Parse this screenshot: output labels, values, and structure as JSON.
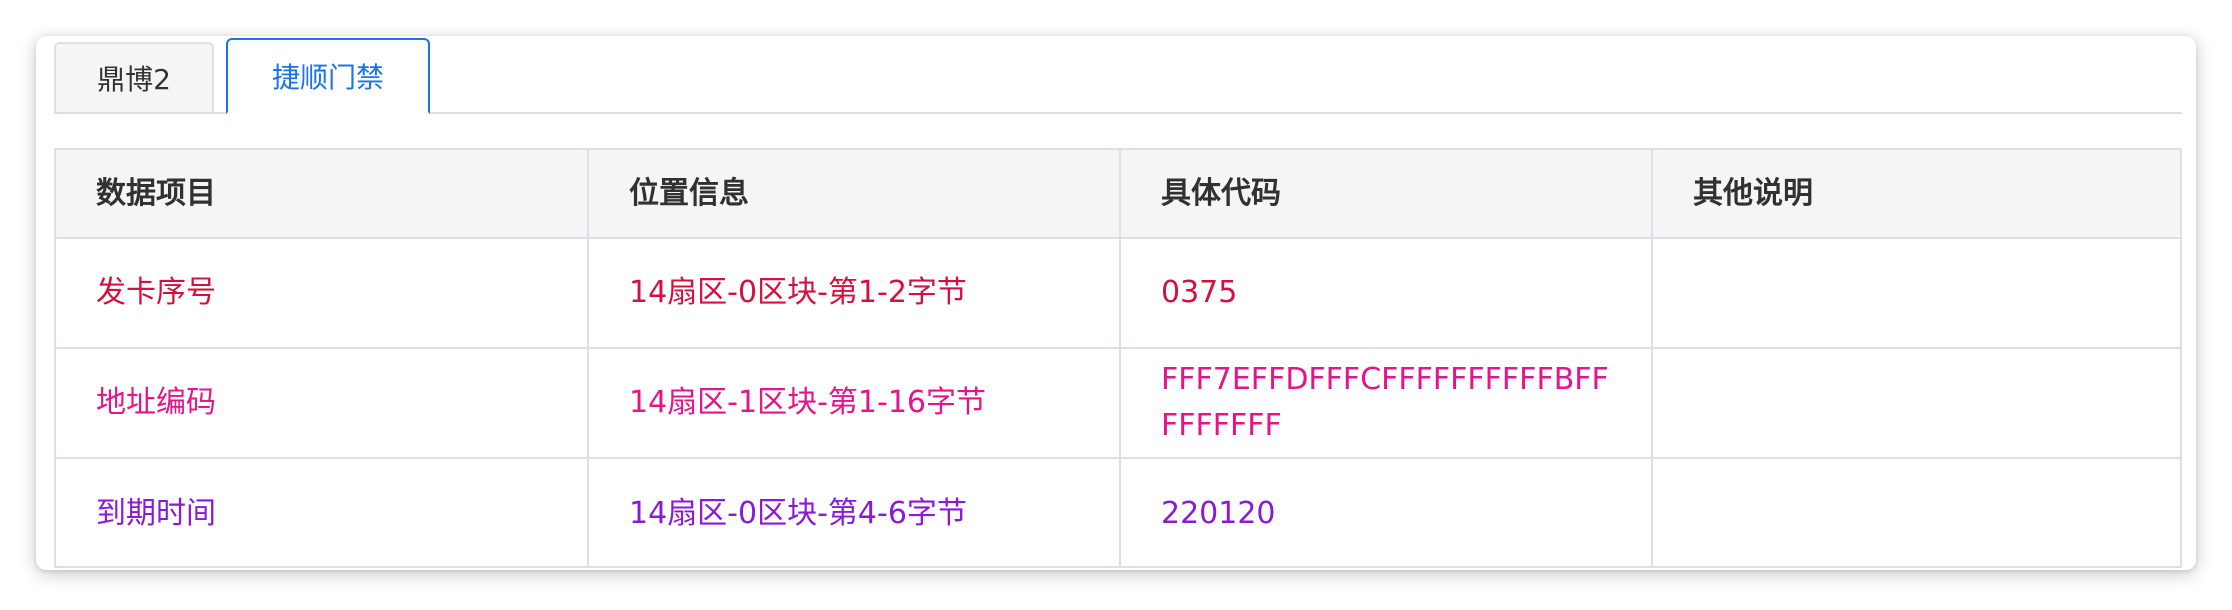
{
  "tabs": [
    {
      "label": "鼎博2",
      "active": false
    },
    {
      "label": "捷顺门禁",
      "active": true
    }
  ],
  "table": {
    "headers": [
      "数据项目",
      "位置信息",
      "具体代码",
      "其他说明"
    ],
    "rows": [
      {
        "item": "发卡序号",
        "location": "14扇区-0区块-第1-2字节",
        "code": "0375",
        "note": "",
        "color": "#d6103e"
      },
      {
        "item": "地址编码",
        "location": "14扇区-1区块-第1-16字节",
        "code": "FFF7EFFDFFFCFFFFFFFFFFBFFFFFFFFF",
        "note": "",
        "color": "#e5148a"
      },
      {
        "item": "到期时间",
        "location": "14扇区-0区块-第4-6字节",
        "code": "220120",
        "note": "",
        "color": "#8a1ad6"
      }
    ]
  },
  "colors": {
    "accent": "#1a73e8",
    "border": "#dcdfe6",
    "header_bg": "#f5f5f5"
  }
}
